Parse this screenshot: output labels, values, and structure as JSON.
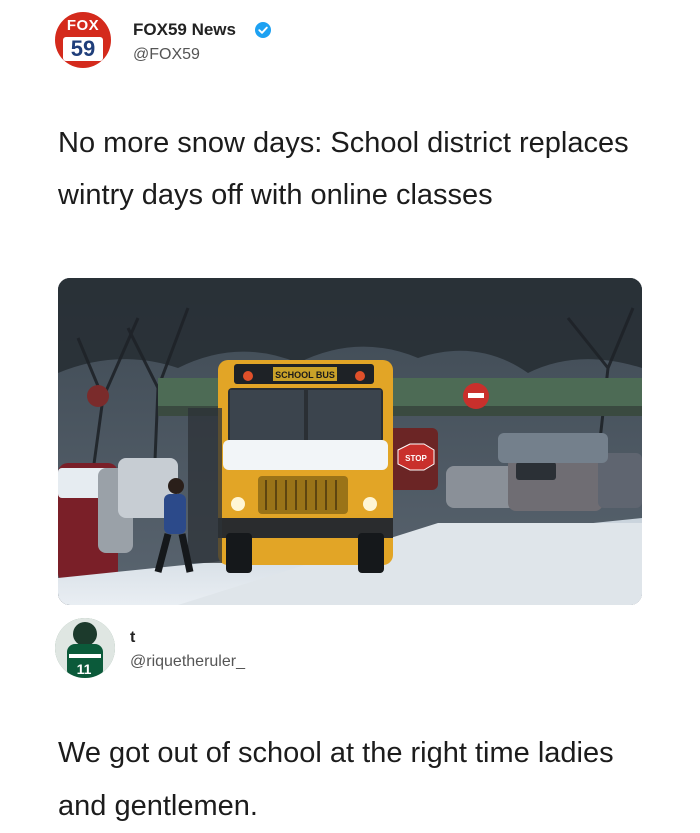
{
  "tweet1": {
    "author_name": "FOX59 News",
    "author_handle": "@FOX59",
    "avatar_top_text": "FOX",
    "avatar_number": "59",
    "verified_icon": "verified-badge-icon",
    "text": "No more snow days: School district replaces wintry days off with online classes",
    "photo_signs": {
      "bus_sign": "SCHOOL BUS",
      "stop_sign": "STOP",
      "road_sign": "DO NOT ENTER"
    }
  },
  "tweet2": {
    "author_name": "t",
    "author_handle": "@riquetheruler_",
    "avatar_jersey_number": "11",
    "text": "We got out of school at the right time ladies and gentlemen."
  },
  "colors": {
    "fox_red": "#d42a1c",
    "fox_blue": "#1f3e7a",
    "verified_blue": "#1da1f2",
    "bus_yellow": "#e2a526"
  }
}
